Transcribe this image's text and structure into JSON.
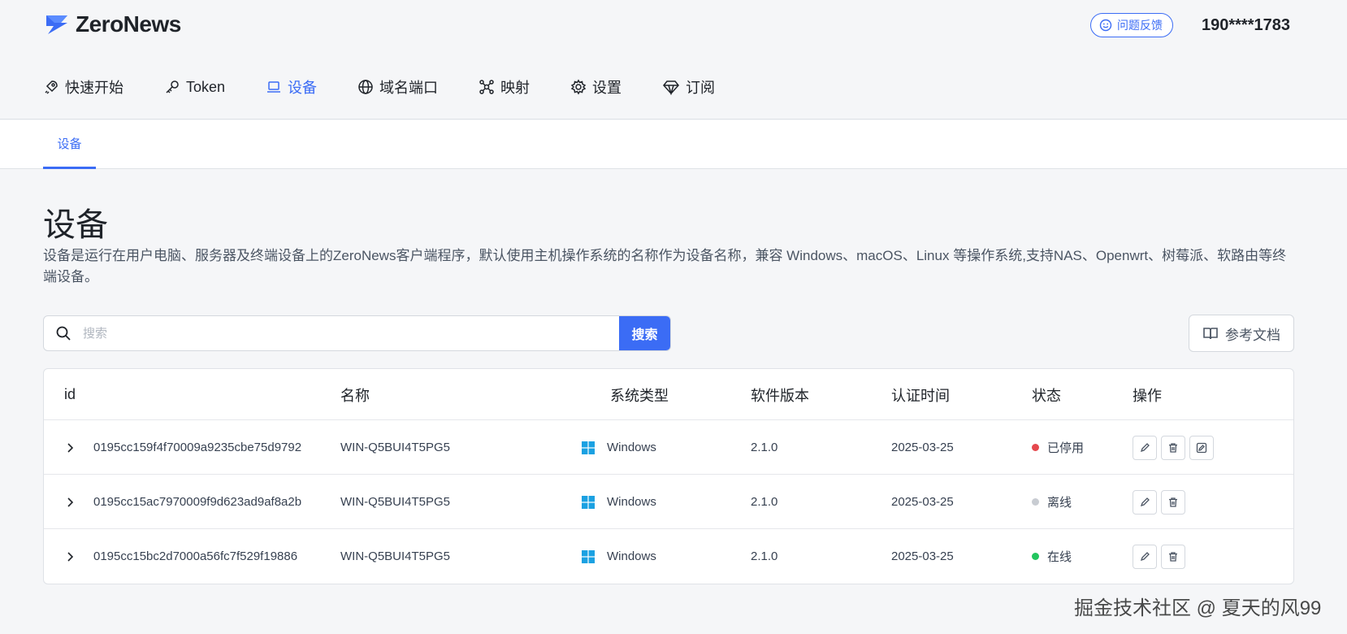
{
  "brand": {
    "name": "ZeroNews",
    "accent": "#3b6cf5"
  },
  "header": {
    "feedback_label": "问题反馈",
    "user": "190****1783"
  },
  "nav": [
    {
      "label": "快速开始",
      "icon": "rocket-icon"
    },
    {
      "label": "Token",
      "icon": "key-icon"
    },
    {
      "label": "设备",
      "icon": "laptop-icon",
      "active": true
    },
    {
      "label": "域名端口",
      "icon": "globe-icon"
    },
    {
      "label": "映射",
      "icon": "network-icon"
    },
    {
      "label": "设置",
      "icon": "gear-icon"
    },
    {
      "label": "订阅",
      "icon": "diamond-icon"
    }
  ],
  "subtab": {
    "label": "设备"
  },
  "page": {
    "title": "设备",
    "description": "设备是运行在用户电脑、服务器及终端设备上的ZeroNews客户端程序，默认使用主机操作系统的名称作为设备名称，兼容 Windows、macOS、Linux 等操作系统,支持NAS、Openwrt、树莓派、软路由等终端设备。"
  },
  "search": {
    "placeholder": "搜索",
    "button_label": "搜索"
  },
  "docs": {
    "label": "参考文档"
  },
  "table": {
    "headers": [
      "id",
      "名称",
      "系统类型",
      "软件版本",
      "认证时间",
      "状态",
      "操作"
    ],
    "rows": [
      {
        "id": "0195cc159f4f70009a9235cbe75d9792",
        "name": "WIN-Q5BUI4T5PG5",
        "os": "Windows",
        "version": "2.1.0",
        "auth_time": "2025-03-25",
        "status": "已停用",
        "status_color": "#e5484d",
        "actions": [
          "edit",
          "delete",
          "enable"
        ]
      },
      {
        "id": "0195cc15ac7970009f9d623ad9af8a2b",
        "name": "WIN-Q5BUI4T5PG5",
        "os": "Windows",
        "version": "2.1.0",
        "auth_time": "2025-03-25",
        "status": "离线",
        "status_color": "#c8ccd2",
        "actions": [
          "edit",
          "delete"
        ]
      },
      {
        "id": "0195cc15bc2d7000a56fc7f529f19886",
        "name": "WIN-Q5BUI4T5PG5",
        "os": "Windows",
        "version": "2.1.0",
        "auth_time": "2025-03-25",
        "status": "在线",
        "status_color": "#22c55e",
        "actions": [
          "edit",
          "delete"
        ]
      }
    ]
  },
  "watermark": "掘金技术社区 @ 夏天的风99"
}
